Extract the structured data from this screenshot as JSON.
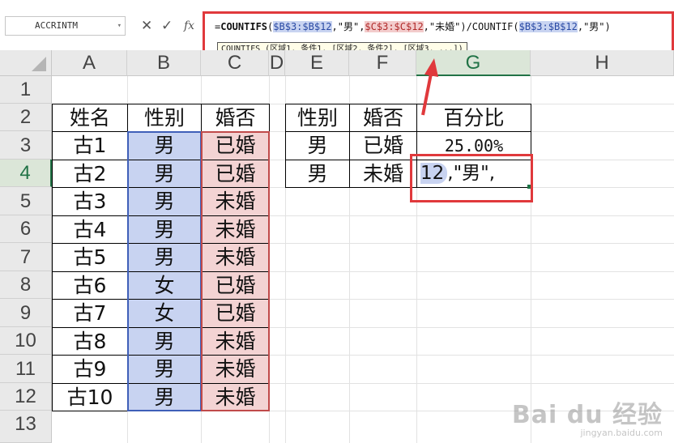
{
  "formula_bar": {
    "name_box": "ACCRINTM",
    "cancel_icon": "✕",
    "confirm_icon": "✓",
    "fx_label": "fx",
    "formula_parts": [
      "=",
      "COUNTIFS",
      "(",
      "$B$3:$B$12",
      ",\"男\",",
      "$C$3:$C$12",
      ",\"未婚\")/COUNTIF(",
      "$B$3:$B$12",
      ",\"男\")"
    ],
    "tooltip": "COUNTIFS (区域1, 条件1, [区域2, 条件2], [区域3, ...])"
  },
  "columns": [
    "A",
    "B",
    "C",
    "D",
    "E",
    "F",
    "G",
    "H"
  ],
  "rows": [
    "1",
    "2",
    "3",
    "4",
    "5",
    "6",
    "7",
    "8",
    "9",
    "10",
    "11",
    "12",
    "13"
  ],
  "table1": {
    "headers": [
      "姓名",
      "性别",
      "婚否"
    ],
    "rows": [
      [
        "古1",
        "男",
        "已婚"
      ],
      [
        "古2",
        "男",
        "已婚"
      ],
      [
        "古3",
        "男",
        "未婚"
      ],
      [
        "古4",
        "男",
        "未婚"
      ],
      [
        "古5",
        "男",
        "未婚"
      ],
      [
        "古6",
        "女",
        "已婚"
      ],
      [
        "古7",
        "女",
        "已婚"
      ],
      [
        "古8",
        "男",
        "未婚"
      ],
      [
        "古9",
        "男",
        "未婚"
      ],
      [
        "古10",
        "男",
        "未婚"
      ]
    ]
  },
  "table2": {
    "headers": [
      "性别",
      "婚否",
      "百分比"
    ],
    "rows": [
      [
        "男",
        "已婚",
        "25.00%"
      ],
      [
        "男",
        "未婚",
        ""
      ]
    ],
    "editing_text_prefix": "12",
    "editing_text_rest": ",\"男\","
  },
  "watermark": {
    "logo": "Bai du 经验",
    "url": "jingyan.baidu.com"
  },
  "colors": {
    "highlight_red": "#e0393c",
    "range_blue": "#c8d3f1",
    "range_pink": "#f3d3d3",
    "active_green": "#217346"
  }
}
